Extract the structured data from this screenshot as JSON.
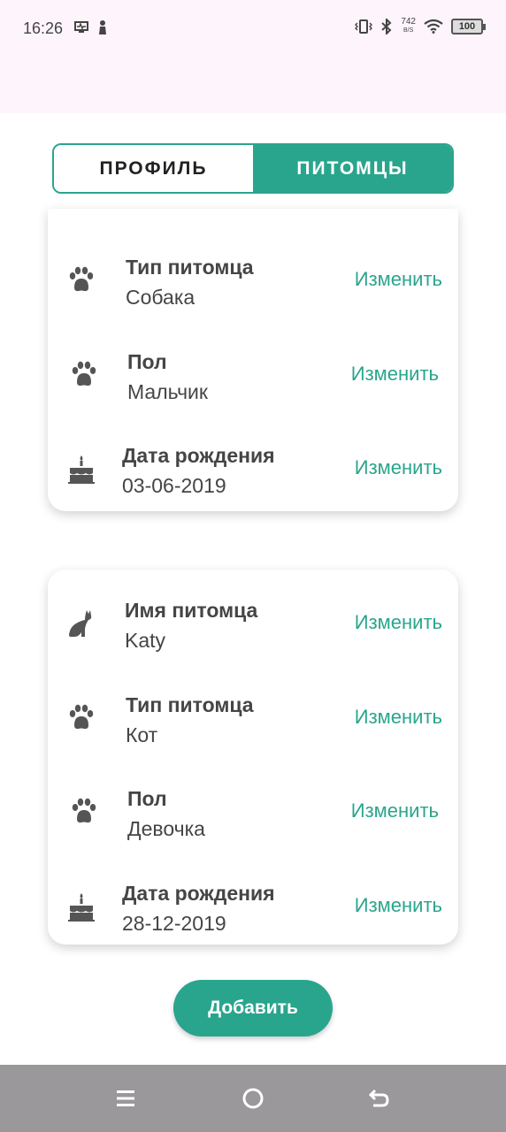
{
  "status_bar": {
    "time": "16:26",
    "net_speed_value": "742",
    "net_speed_unit": "B/S",
    "battery": "100"
  },
  "tabs": {
    "profile": "ПРОФИЛЬ",
    "pets": "ПИТОМЦЫ",
    "selected": "pets"
  },
  "colors": {
    "accent": "#2aa58d",
    "status_bg": "#fdf5fb",
    "nav_bg": "#9a989b"
  },
  "pets": [
    {
      "fields": [
        {
          "icon": "paw-icon",
          "label": "Тип питомца",
          "value": "Собака",
          "action": "Изменить"
        },
        {
          "icon": "paw-icon",
          "label": "Пол",
          "value": "Мальчик",
          "action": "Изменить"
        },
        {
          "icon": "cake-icon",
          "label": "Дата рождения",
          "value": "03-06-2019",
          "action": "Изменить"
        }
      ]
    },
    {
      "fields": [
        {
          "icon": "cat-icon",
          "label": "Имя питомца",
          "value": "Katy",
          "action": "Изменить"
        },
        {
          "icon": "paw-icon",
          "label": "Тип питомца",
          "value": "Кот",
          "action": "Изменить"
        },
        {
          "icon": "paw-icon",
          "label": "Пол",
          "value": "Девочка",
          "action": "Изменить"
        },
        {
          "icon": "cake-icon",
          "label": "Дата рождения",
          "value": "28-12-2019",
          "action": "Изменить"
        }
      ]
    }
  ],
  "add_button": "Добавить"
}
